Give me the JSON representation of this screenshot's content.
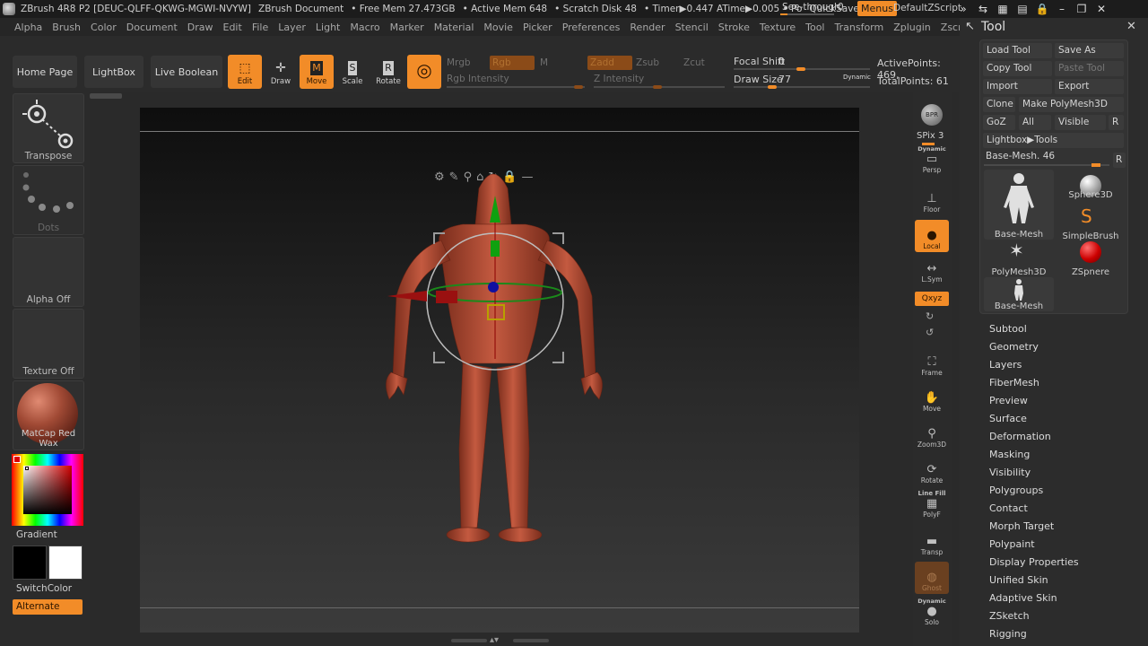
{
  "titlebar": {
    "app": "ZBrush 4R8 P2 [DEUC-QLFF-QKWG-MGWI-NVYW]",
    "document": "ZBrush Document",
    "free_mem": "• Free Mem 27.473GB",
    "active_mem": "• Active Mem 648",
    "scratch": "• Scratch Disk 48",
    "timer": "• Timer▶0.447 ATime▶0.005 • Po",
    "quicksave": "QuickSave",
    "see_through_label": "See-through",
    "see_through_value": "0",
    "menus": "Menus",
    "default_zscript": "DefaultZScript"
  },
  "menubar": [
    "Alpha",
    "Brush",
    "Color",
    "Document",
    "Draw",
    "Edit",
    "File",
    "Layer",
    "Light",
    "Macro",
    "Marker",
    "Material",
    "Movie",
    "Picker",
    "Preferences",
    "Render",
    "Stencil",
    "Stroke",
    "Texture",
    "Tool",
    "Transform",
    "Zplugin",
    "Zscript"
  ],
  "toolbar": {
    "home_page": "Home Page",
    "lightbox": "LightBox",
    "live_boolean": "Live Boolean",
    "edit": "Edit",
    "draw": "Draw",
    "move": "Move",
    "scale": "Scale",
    "rotate": "Rotate",
    "mrgb": "Mrgb",
    "rgb": "Rgb",
    "m": "M",
    "zadd": "Zadd",
    "zsub": "Zsub",
    "zcut": "Zcut",
    "rgb_intensity": "Rgb Intensity",
    "z_intensity": "Z Intensity",
    "focal_shift_label": "Focal Shift",
    "focal_shift_value": "0",
    "draw_size_label": "Draw Size",
    "draw_size_value": "77",
    "dynamic": "Dynamic",
    "active_points": "ActivePoints: 469,",
    "total_points": "TotalPoints: 61"
  },
  "leftshelf": {
    "transpose": "Transpose",
    "dots": "Dots",
    "alpha_off": "Alpha Off",
    "texture_off": "Texture Off",
    "material": "MatCap Red Wax",
    "gradient": "Gradient",
    "switch_color": "SwitchColor",
    "alternate": "Alternate"
  },
  "rightshelf": {
    "bpr": "BPR",
    "spix_label": "SPix",
    "spix_value": "3",
    "persp_top": "Dynamic",
    "persp": "Persp",
    "floor": "Floor",
    "local": "Local",
    "lsym": "L.Sym",
    "xyz": "Qxyz",
    "frame": "Frame",
    "move": "Move",
    "zoom3d": "Zoom3D",
    "rotate": "Rotate",
    "linefill": "Line Fill",
    "polyf": "PolyF",
    "transp": "Transp",
    "ghost": "Ghost",
    "solo_top": "Dynamic",
    "solo": "Solo"
  },
  "toolpanel": {
    "title": "Tool",
    "load_tool": "Load Tool",
    "save_as": "Save As",
    "copy_tool": "Copy Tool",
    "paste_tool": "Paste Tool",
    "import": "Import",
    "export": "Export",
    "clone": "Clone",
    "make_polymesh": "Make PolyMesh3D",
    "goz": "GoZ",
    "all": "All",
    "visible": "Visible",
    "r": "R",
    "lightbox_tools": "Lightbox▶Tools",
    "base_mesh_label": "Base-Mesh.",
    "base_mesh_value": "46",
    "thumbs": [
      "Base-Mesh",
      "Sphere3D",
      "SimpleBrush",
      "PolyMesh3D",
      "ZSpnere",
      "Base-Mesh"
    ],
    "subpalettes": [
      "Subtool",
      "Geometry",
      "Layers",
      "FiberMesh",
      "Preview",
      "Surface",
      "Deformation",
      "Masking",
      "Visibility",
      "Polygroups",
      "Contact",
      "Morph Target",
      "Polypaint",
      "Display Properties",
      "Unified Skin",
      "Adaptive Skin",
      "ZSketch",
      "Rigging"
    ]
  },
  "colors": {
    "accent": "#f28c28",
    "model": "#b5513a",
    "panel": "#2b2b2b"
  }
}
